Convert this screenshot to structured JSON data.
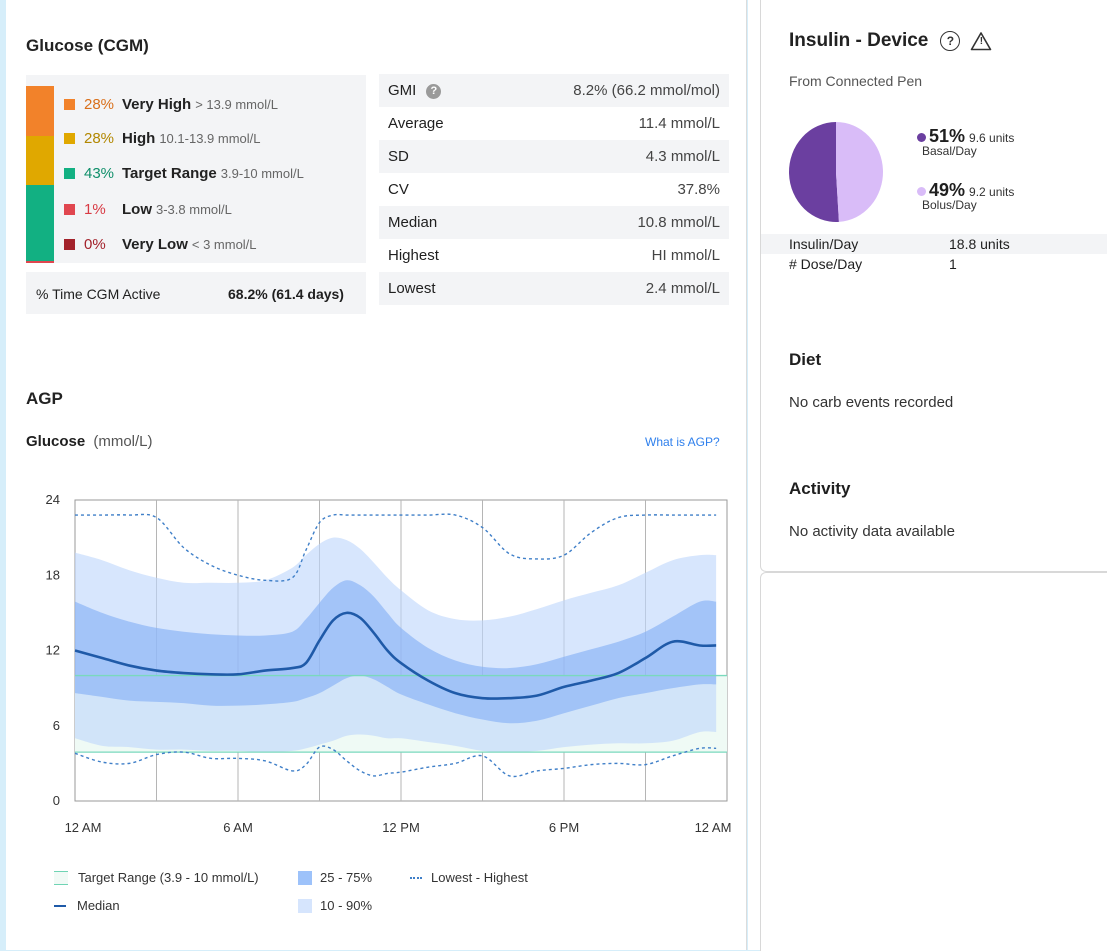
{
  "glucose_section": {
    "title": "Glucose (CGM)",
    "ranges": [
      {
        "pct": "28%",
        "label": "Very High",
        "range": "> 13.9 mmol/L",
        "color": "#f2822a",
        "pct_color": "#d96f1a",
        "fraction": 0.28
      },
      {
        "pct": "28%",
        "label": "High",
        "range": "10.1-13.9 mmol/L",
        "color": "#e0a800",
        "pct_color": "#b28700",
        "fraction": 0.28
      },
      {
        "pct": "43%",
        "label": "Target Range",
        "range": "3.9-10 mmol/L",
        "color": "#12b082",
        "pct_color": "#0f8f6a",
        "fraction": 0.43
      },
      {
        "pct": "1%",
        "label": "Low",
        "range": "3-3.8 mmol/L",
        "color": "#e0464f",
        "pct_color": "#d83a44",
        "fraction": 0.01
      },
      {
        "pct": "0%",
        "label": "Very Low",
        "range": "< 3 mmol/L",
        "color": "#a3222b",
        "pct_color": "#a3222b",
        "fraction": 0.0
      }
    ],
    "cgm_active_label": "% Time CGM Active",
    "cgm_active_value": "68.2% (61.4 days)",
    "stats": [
      {
        "label": "GMI",
        "value": "8.2% (66.2 mmol/mol)",
        "help": "?"
      },
      {
        "label": "Average",
        "value": "11.4 mmol/L"
      },
      {
        "label": "SD",
        "value": "4.3 mmol/L"
      },
      {
        "label": "CV",
        "value": "37.8%"
      },
      {
        "label": "Median",
        "value": "10.8 mmol/L"
      },
      {
        "label": "Highest",
        "value": "HI mmol/L"
      },
      {
        "label": "Lowest",
        "value": "2.4 mmol/L"
      }
    ]
  },
  "agp": {
    "title": "AGP",
    "axis_title": "Glucose",
    "axis_unit": "(mmol/L)",
    "what_is_link": "What is AGP?",
    "legend": {
      "target": "Target Range (3.9 - 10 mmol/L)",
      "median": "Median",
      "p25_75": "25 - 75%",
      "p10_90": "10 - 90%",
      "lowest_highest": "Lowest - Highest"
    }
  },
  "chart_data": {
    "type": "area",
    "ylabel": "Glucose (mmol/L)",
    "ylim": [
      0,
      24
    ],
    "y_ticks": [
      "24",
      "18",
      "12",
      "6",
      "0"
    ],
    "x_ticks": [
      "12 AM",
      "6 AM",
      "12 PM",
      "6 PM",
      "12 AM"
    ],
    "xlim_hours": [
      0,
      24
    ],
    "grid": true,
    "target_range": [
      3.9,
      10
    ],
    "x_hours": [
      0,
      1,
      2,
      3,
      4,
      5,
      6,
      7,
      8,
      8.5,
      9,
      9.5,
      10,
      10.5,
      11,
      11.5,
      12,
      13,
      14,
      15,
      16,
      17,
      18,
      19,
      20,
      21,
      22,
      23,
      23
    ],
    "series": [
      {
        "name": "10 - 90%",
        "low": [
          5.0,
          4.4,
          4.3,
          4.1,
          4.1,
          4.0,
          4.0,
          3.9,
          4.0,
          4.2,
          4.5,
          4.8,
          5.2,
          5.3,
          5.2,
          5.0,
          5.0,
          4.7,
          4.4,
          4.0,
          3.9,
          4.0,
          4.3,
          4.5,
          4.6,
          4.6,
          4.8,
          5.5,
          5.5
        ],
        "high": [
          19.8,
          19.2,
          18.4,
          17.8,
          17.4,
          17.4,
          17.4,
          17.6,
          18.6,
          19.6,
          20.5,
          21.0,
          20.8,
          20.1,
          19.0,
          17.8,
          16.8,
          15.2,
          14.5,
          14.4,
          14.7,
          15.3,
          16.0,
          16.6,
          17.2,
          18.2,
          19.2,
          19.6,
          19.6
        ]
      },
      {
        "name": "25 - 75%",
        "low": [
          8.6,
          8.3,
          8.0,
          7.9,
          7.8,
          7.6,
          7.6,
          7.7,
          7.9,
          8.2,
          8.6,
          9.2,
          9.8,
          10.0,
          9.7,
          9.1,
          8.5,
          7.7,
          7.0,
          6.5,
          6.2,
          6.4,
          7.0,
          7.6,
          8.2,
          8.6,
          9.0,
          9.3,
          9.3
        ],
        "high": [
          15.9,
          15.0,
          14.3,
          13.8,
          13.5,
          13.3,
          13.2,
          13.2,
          13.5,
          14.5,
          15.8,
          17.0,
          17.6,
          17.2,
          16.3,
          15.0,
          13.8,
          12.2,
          11.2,
          10.7,
          10.6,
          10.9,
          11.5,
          12.1,
          12.7,
          13.5,
          14.7,
          15.9,
          15.9
        ]
      },
      {
        "name": "Median",
        "values": [
          12.0,
          11.4,
          10.8,
          10.4,
          10.2,
          10.1,
          10.1,
          10.4,
          10.6,
          11.0,
          12.8,
          14.4,
          15.0,
          14.6,
          13.4,
          12.0,
          11.0,
          9.6,
          8.6,
          8.2,
          8.2,
          8.4,
          9.1,
          9.6,
          10.2,
          11.4,
          12.7,
          12.4,
          12.4
        ]
      },
      {
        "name": "Lowest - Highest (high)",
        "values": [
          22.8,
          22.8,
          22.8,
          22.6,
          20.2,
          18.8,
          18.0,
          17.6,
          17.8,
          20.0,
          22.2,
          22.8,
          22.8,
          22.8,
          22.8,
          22.8,
          22.8,
          22.8,
          22.8,
          21.8,
          19.7,
          19.3,
          19.6,
          21.4,
          22.6,
          22.8,
          22.8,
          22.8,
          22.8
        ]
      },
      {
        "name": "Lowest - Highest (low)",
        "values": [
          3.8,
          3.1,
          3.0,
          3.7,
          3.9,
          3.4,
          3.4,
          3.2,
          2.4,
          2.9,
          4.3,
          4.1,
          3.2,
          2.4,
          2.0,
          2.2,
          2.3,
          2.7,
          3.0,
          3.6,
          2.0,
          2.4,
          2.6,
          2.9,
          3.0,
          2.9,
          3.6,
          4.2,
          4.2
        ]
      }
    ]
  },
  "insulin": {
    "title": "Insulin - Device",
    "help_icon": "?",
    "warning_icon": "!",
    "source": "From Connected Pen",
    "basal": {
      "pct": "51%",
      "units": "9.6 units",
      "label": "Basal/Day",
      "fraction": 0.51,
      "color": "#6b3fa0"
    },
    "bolus": {
      "pct": "49%",
      "units": "9.2 units",
      "label": "Bolus/Day",
      "fraction": 0.49,
      "color": "#d9bcf8"
    },
    "table": [
      {
        "k": "Insulin/Day",
        "v": "18.8 units"
      },
      {
        "k": "# Dose/Day",
        "v": "1"
      }
    ]
  },
  "diet": {
    "title": "Diet",
    "text": "No carb events recorded"
  },
  "activity": {
    "title": "Activity",
    "text": "No activity data available"
  }
}
